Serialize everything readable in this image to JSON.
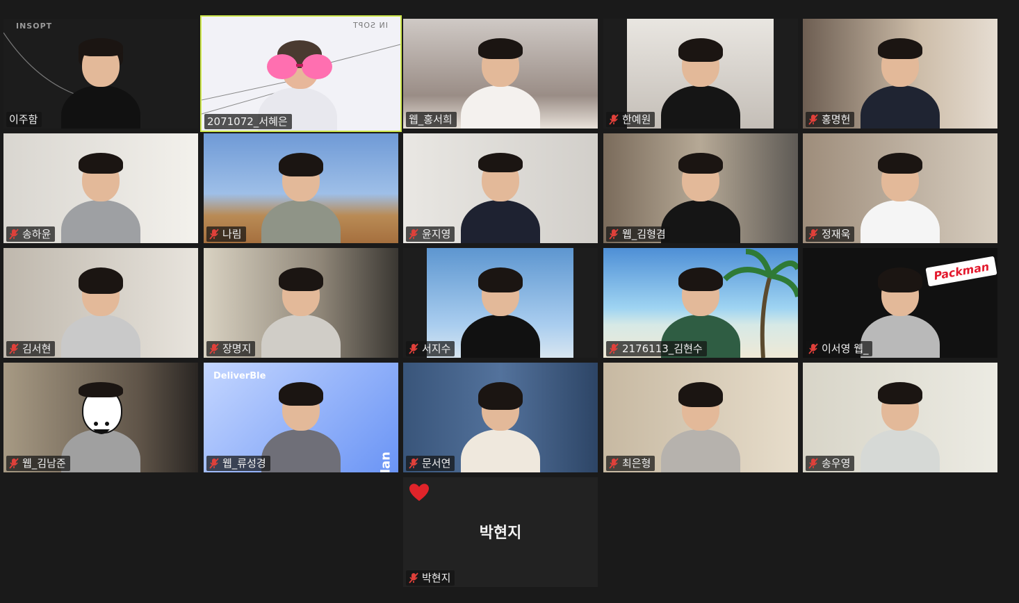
{
  "participants": [
    {
      "name": "이주함",
      "muted": false
    },
    {
      "name": "2071072_서혜은",
      "muted": false
    },
    {
      "name": "웹_홍서희",
      "muted": false
    },
    {
      "name": "한예원",
      "muted": true
    },
    {
      "name": "홍명헌",
      "muted": true
    },
    {
      "name": "송하윤",
      "muted": true
    },
    {
      "name": "나림",
      "muted": true
    },
    {
      "name": "윤지영",
      "muted": true
    },
    {
      "name": "웹_김형겸",
      "muted": true
    },
    {
      "name": "정재욱",
      "muted": true
    },
    {
      "name": "김서현",
      "muted": true
    },
    {
      "name": "장명지",
      "muted": true
    },
    {
      "name": "서지수",
      "muted": true
    },
    {
      "name": "2176113_김현수",
      "muted": true
    },
    {
      "name": "이서영 웹_",
      "muted": true
    },
    {
      "name": "웹_김남준",
      "muted": true
    },
    {
      "name": "웹_류성경",
      "muted": true
    },
    {
      "name": "문서연",
      "muted": true
    },
    {
      "name": "최은형",
      "muted": true
    },
    {
      "name": "송우영",
      "muted": true
    },
    {
      "name": "박현지",
      "muted": true
    }
  ],
  "avatar_tile": {
    "display_name": "박현지",
    "reaction": "heart-icon"
  },
  "active_speaker_index": 1,
  "background_text": {
    "tile_0_logo": "INSOPT",
    "tile_1_logo": "IN SOPT",
    "tile_14_sign": "Packman",
    "tile_16_brand": "DeliverBle",
    "tile_16_side": "Plan"
  },
  "colors": {
    "page_bg": "#1a1a1a",
    "active_border": "#cfe84c",
    "muted_mic": "#e0403a",
    "heart": "#e0242a"
  }
}
